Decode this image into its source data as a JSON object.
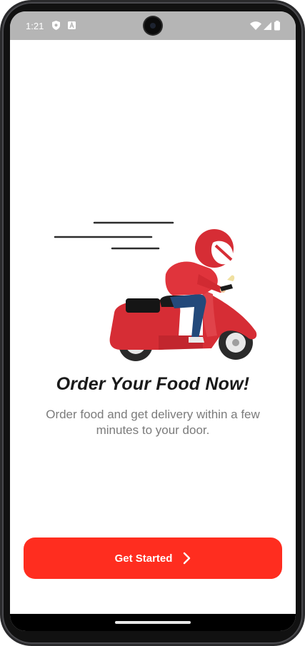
{
  "status_bar": {
    "time": "1:21",
    "icons": [
      "shield-icon",
      "a-badge-icon",
      "wifi-icon",
      "signal-icon",
      "battery-icon"
    ]
  },
  "onboarding": {
    "illustration": "delivery-scooter-illustration",
    "title": "Order Your Food Now!",
    "subtitle": "Order food and get delivery within a few minutes to your door."
  },
  "cta": {
    "label": "Get Started",
    "icon": "chevron-right-icon"
  },
  "colors": {
    "accent": "#ff2d1f",
    "status_bar": "#b5b5b5",
    "title": "#1a1a1a",
    "subtitle": "#7b7b7b"
  }
}
